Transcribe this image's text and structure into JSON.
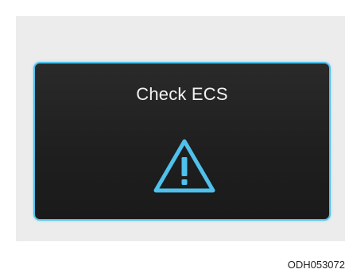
{
  "display": {
    "message": "Check ECS",
    "icon": "warning-triangle-icon",
    "accent_color": "#4fc1ec"
  },
  "figure_code": "ODH053072"
}
